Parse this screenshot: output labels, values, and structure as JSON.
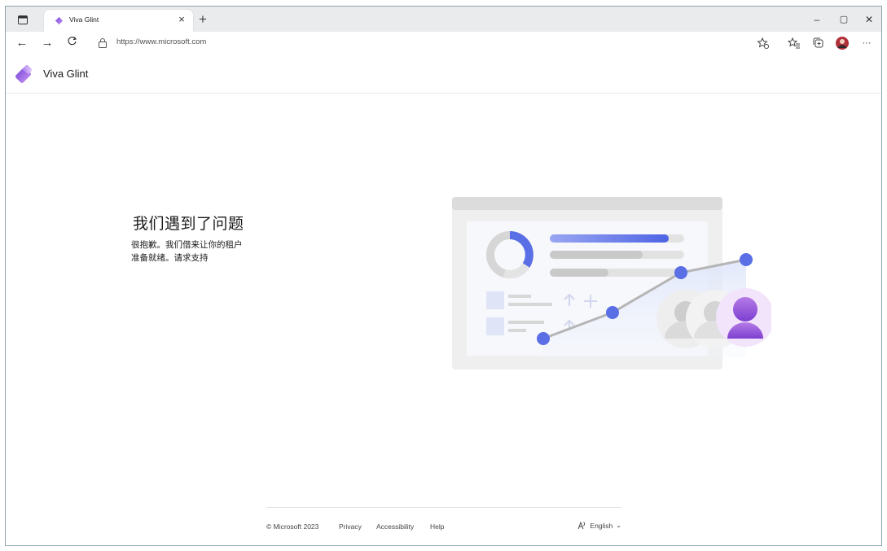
{
  "browser": {
    "tab": {
      "title": "Viva Glint"
    },
    "new_tab_label": "+",
    "address_url": "https://www.microsoft.com",
    "window_controls": {
      "minimize": "–",
      "maximize": "▢",
      "close": "✕"
    },
    "more_label": "···"
  },
  "header": {
    "brand": "Viva Glint"
  },
  "error": {
    "title": "我们遇到了问题",
    "line1": "很抱歉。我们借来让你的租户",
    "line2": "准备就绪。请求支持"
  },
  "footer": {
    "copyright": "© Microsoft 2023",
    "links": [
      "Privacy",
      "Accessibility",
      "Help"
    ],
    "language": "English"
  },
  "icons": {
    "tab_menu": "tab-actions-icon",
    "back": "back-arrow-icon",
    "forward": "forward-arrow-icon",
    "refresh": "refresh-icon",
    "lock": "lock-icon",
    "favorite_add": "add-favorite-icon",
    "favorites": "favorites-icon",
    "collections": "collections-icon",
    "profile": "profile-avatar-icon",
    "language": "language-icon"
  },
  "colors": {
    "accent_blue": "#5a6ee6",
    "accent_purple": "#9e63d9",
    "brand_gradient_start": "#7b4fe0",
    "brand_gradient_end": "#c48cf0"
  }
}
